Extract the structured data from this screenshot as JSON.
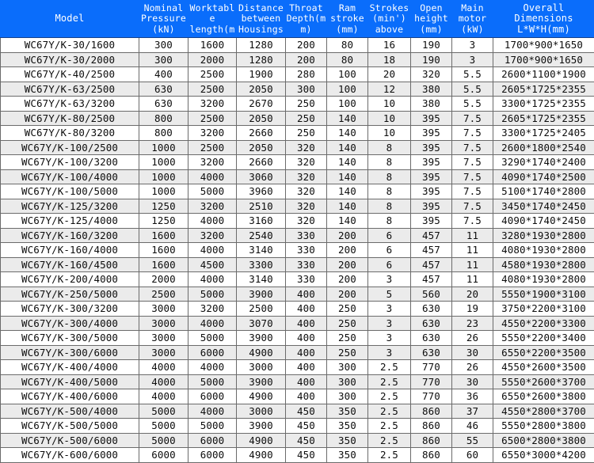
{
  "table": {
    "headers": [
      "Model",
      "Nominal Pressure(kN)",
      "Worktable length(m",
      "Distance between Housings",
      "Throat Depth(mm)",
      "Ram stroke (mm)",
      "Strokes (min') above",
      "Open height (mm)",
      "Main motor (kW)",
      "Overall Dimensions L*W*H(mm)"
    ],
    "header_colors": {
      "background": "#0a6dfb",
      "text": "#ffffff"
    },
    "row_colors": {
      "odd": "#ffffff",
      "even": "#ebebeb",
      "border": "#6b6b6b",
      "text": "#0d0d0d"
    },
    "rows": [
      [
        "WC67Y/K-30/1600",
        "300",
        "1600",
        "1280",
        "200",
        "80",
        "16",
        "190",
        "3",
        "1700*900*1650"
      ],
      [
        "WC67Y/K-30/2000",
        "300",
        "2000",
        "1280",
        "200",
        "80",
        "18",
        "190",
        "3",
        "1700*900*1650"
      ],
      [
        "WC67Y/K-40/2500",
        "400",
        "2500",
        "1900",
        "280",
        "100",
        "20",
        "320",
        "5.5",
        "2600*1100*1900"
      ],
      [
        "WC67Y/K-63/2500",
        "630",
        "2500",
        "2050",
        "300",
        "100",
        "12",
        "380",
        "5.5",
        "2605*1725*2355"
      ],
      [
        "WC67Y/K-63/3200",
        "630",
        "3200",
        "2670",
        "250",
        "100",
        "10",
        "380",
        "5.5",
        "3300*1725*2355"
      ],
      [
        "WC67Y/K-80/2500",
        "800",
        "2500",
        "2050",
        "250",
        "140",
        "10",
        "395",
        "7.5",
        "2605*1725*2355"
      ],
      [
        "WC67Y/K-80/3200",
        "800",
        "3200",
        "2660",
        "250",
        "140",
        "10",
        "395",
        "7.5",
        "3300*1725*2405"
      ],
      [
        "WC67Y/K-100/2500",
        "1000",
        "2500",
        "2050",
        "320",
        "140",
        "8",
        "395",
        "7.5",
        "2600*1800*2540"
      ],
      [
        "WC67Y/K-100/3200",
        "1000",
        "3200",
        "2660",
        "320",
        "140",
        "8",
        "395",
        "7.5",
        "3290*1740*2400"
      ],
      [
        "WC67Y/K-100/4000",
        "1000",
        "4000",
        "3060",
        "320",
        "140",
        "8",
        "395",
        "7.5",
        "4090*1740*2500"
      ],
      [
        "WC67Y/K-100/5000",
        "1000",
        "5000",
        "3960",
        "320",
        "140",
        "8",
        "395",
        "7.5",
        "5100*1740*2800"
      ],
      [
        "WC67Y/K-125/3200",
        "1250",
        "3200",
        "2510",
        "320",
        "140",
        "8",
        "395",
        "7.5",
        "3450*1740*2450"
      ],
      [
        "WC67Y/K-125/4000",
        "1250",
        "4000",
        "3160",
        "320",
        "140",
        "8",
        "395",
        "7.5",
        "4090*1740*2450"
      ],
      [
        "WC67Y/K-160/3200",
        "1600",
        "3200",
        "2540",
        "330",
        "200",
        "6",
        "457",
        "11",
        "3280*1930*2800"
      ],
      [
        "WC67Y/K-160/4000",
        "1600",
        "4000",
        "3140",
        "330",
        "200",
        "6",
        "457",
        "11",
        "4080*1930*2800"
      ],
      [
        "WC67Y/K-160/4500",
        "1600",
        "4500",
        "3300",
        "330",
        "200",
        "6",
        "457",
        "11",
        "4580*1930*2800"
      ],
      [
        "WC67Y/K-200/4000",
        "2000",
        "4000",
        "3140",
        "330",
        "200",
        "3",
        "457",
        "11",
        "4080*1930*2800"
      ],
      [
        "WC67Y/K-250/5000",
        "2500",
        "5000",
        "3900",
        "400",
        "200",
        "5",
        "560",
        "20",
        "5550*1900*3100"
      ],
      [
        "WC67Y/K-300/3200",
        "3000",
        "3200",
        "2500",
        "400",
        "250",
        "3",
        "630",
        "19",
        "3750*2200*3100"
      ],
      [
        "WC67Y/K-300/4000",
        "3000",
        "4000",
        "3070",
        "400",
        "250",
        "3",
        "630",
        "23",
        "4550*2200*3300"
      ],
      [
        "WC67Y/K-300/5000",
        "3000",
        "5000",
        "3900",
        "400",
        "250",
        "3",
        "630",
        "26",
        "5550*2200*3400"
      ],
      [
        "WC67Y/K-300/6000",
        "3000",
        "6000",
        "4900",
        "400",
        "250",
        "3",
        "630",
        "30",
        "6550*2200*3500"
      ],
      [
        "WC67Y/K-400/4000",
        "4000",
        "4000",
        "3000",
        "400",
        "300",
        "2.5",
        "770",
        "26",
        "4550*2600*3500"
      ],
      [
        "WC67Y/K-400/5000",
        "4000",
        "5000",
        "3900",
        "400",
        "300",
        "2.5",
        "770",
        "30",
        "5550*2600*3700"
      ],
      [
        "WC67Y/K-400/6000",
        "4000",
        "6000",
        "4900",
        "400",
        "300",
        "2.5",
        "770",
        "36",
        "6550*2600*3800"
      ],
      [
        "WC67Y/K-500/4000",
        "5000",
        "4000",
        "3000",
        "450",
        "350",
        "2.5",
        "860",
        "37",
        "4550*2800*3700"
      ],
      [
        "WC67Y/K-500/5000",
        "5000",
        "5000",
        "3900",
        "450",
        "350",
        "2.5",
        "860",
        "46",
        "5550*2800*3800"
      ],
      [
        "WC67Y/K-500/6000",
        "5000",
        "6000",
        "4900",
        "450",
        "350",
        "2.5",
        "860",
        "55",
        "6500*2800*3800"
      ],
      [
        "WC67Y/K-600/6000",
        "6000",
        "6000",
        "4900",
        "450",
        "350",
        "2.5",
        "860",
        "60",
        "6550*3000*4200"
      ]
    ]
  }
}
